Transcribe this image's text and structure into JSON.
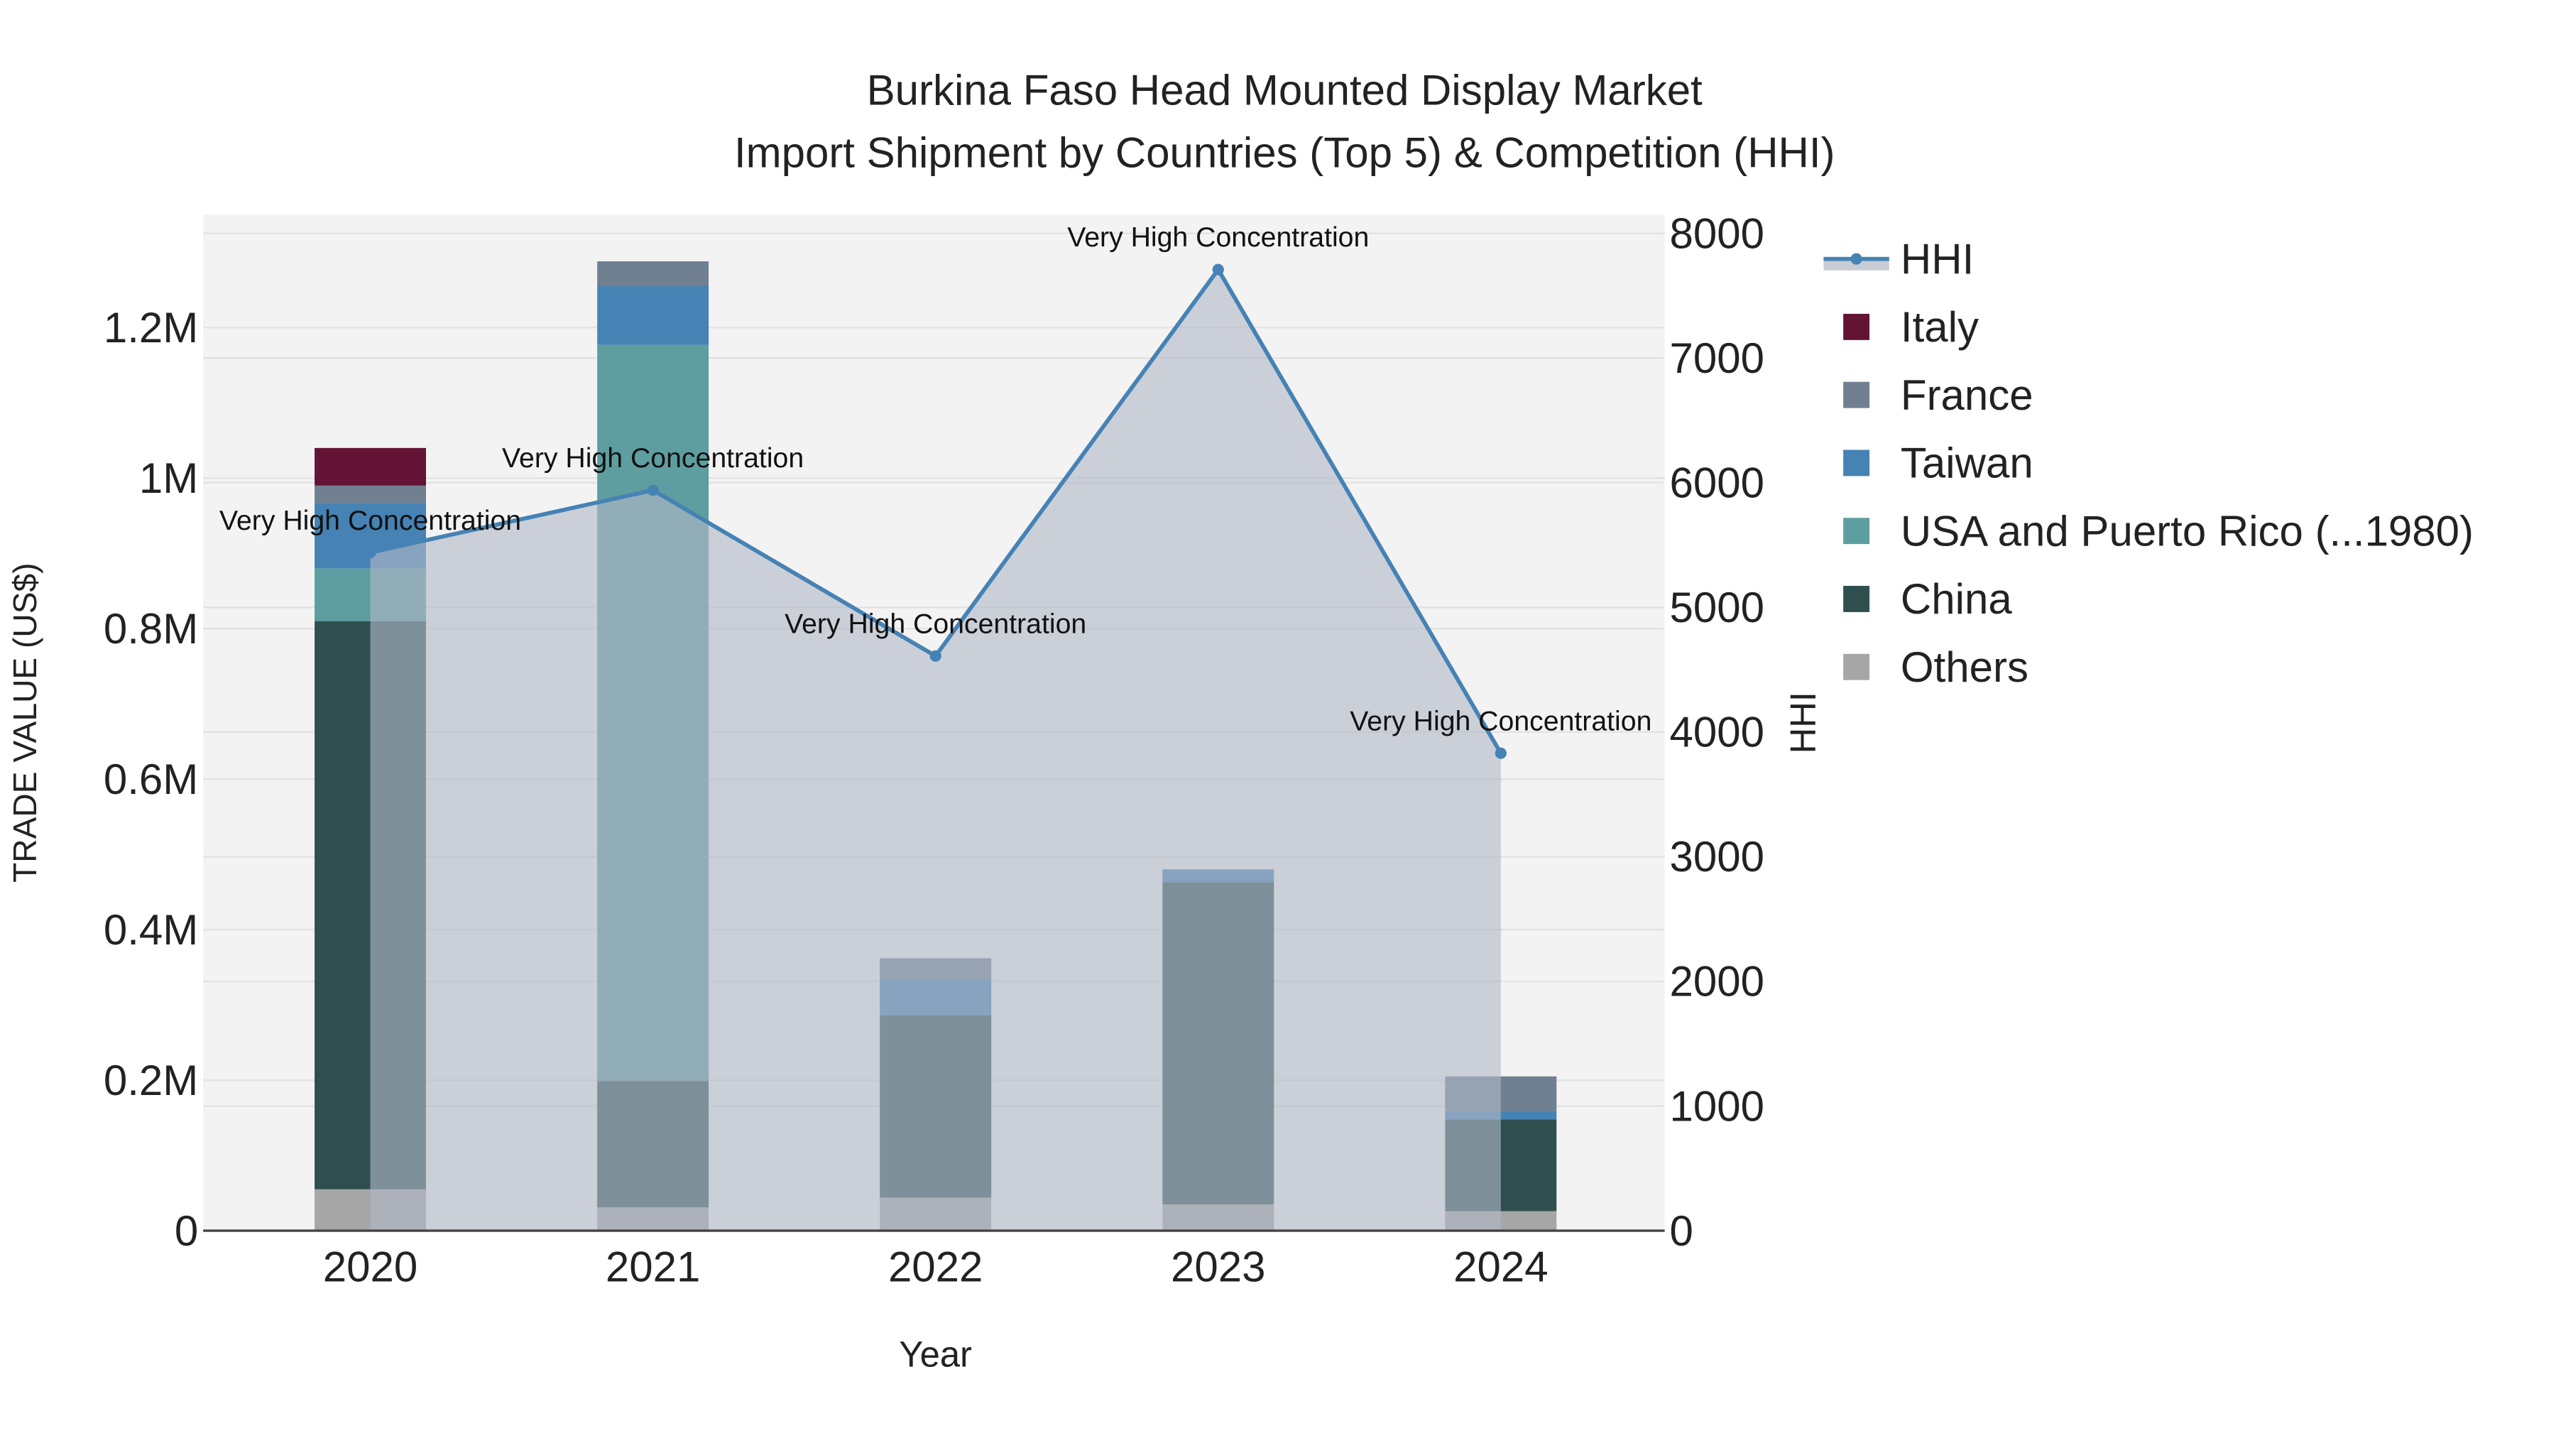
{
  "chart_data": {
    "type": "bar",
    "title": "Burkina Faso Head Mounted Display Market",
    "subtitle": "Import Shipment by Countries (Top 5) & Competition (HHI)",
    "xlabel": "Year",
    "ylabel": "TRADE VALUE (US$)",
    "y2label": "HHI",
    "categories": [
      "2020",
      "2021",
      "2022",
      "2023",
      "2024"
    ],
    "ylim": [
      0,
      1350000
    ],
    "y_ticks": [
      0,
      200000,
      400000,
      600000,
      800000,
      1000000,
      1200000
    ],
    "y_tick_labels": [
      "0",
      "0.2M",
      "0.4M",
      "0.6M",
      "0.8M",
      "1M",
      "1.2M"
    ],
    "y2lim": [
      0,
      8150
    ],
    "y2_ticks": [
      0,
      1000,
      2000,
      3000,
      4000,
      5000,
      6000,
      7000,
      8000
    ],
    "y2_tick_labels": [
      "0",
      "1000",
      "2000",
      "3000",
      "4000",
      "5000",
      "6000",
      "7000",
      "8000"
    ],
    "series": [
      {
        "name": "Others",
        "color": "#a6a6a6",
        "values": [
          55000,
          31000,
          44000,
          35000,
          26000
        ]
      },
      {
        "name": "China",
        "color": "#2f4f4f",
        "values": [
          755000,
          168000,
          242000,
          428000,
          122000
        ]
      },
      {
        "name": "USA and Puerto Rico (...1980)",
        "color": "#5f9ea0",
        "values": [
          70000,
          978000,
          0,
          0,
          0
        ]
      },
      {
        "name": "Taiwan",
        "color": "#4682b4",
        "values": [
          87000,
          78000,
          48000,
          17000,
          11000
        ]
      },
      {
        "name": "France",
        "color": "#708090",
        "values": [
          23000,
          33000,
          28000,
          0,
          46000
        ]
      },
      {
        "name": "Italy",
        "color": "#631435",
        "values": [
          50000,
          0,
          0,
          0,
          0
        ]
      }
    ],
    "hhi": {
      "name": "HHI",
      "color": "#4682b4",
      "values": [
        5440,
        5940,
        4610,
        7710,
        3830
      ],
      "annotations": [
        "Very High Concentration",
        "Very High Concentration",
        "Very High Concentration",
        "Very High Concentration",
        "Very High Concentration"
      ]
    },
    "legend_order": [
      "HHI",
      "Italy",
      "France",
      "Taiwan",
      "USA and Puerto Rico (...1980)",
      "China",
      "Others"
    ],
    "legend_position": "right",
    "grid": true
  }
}
